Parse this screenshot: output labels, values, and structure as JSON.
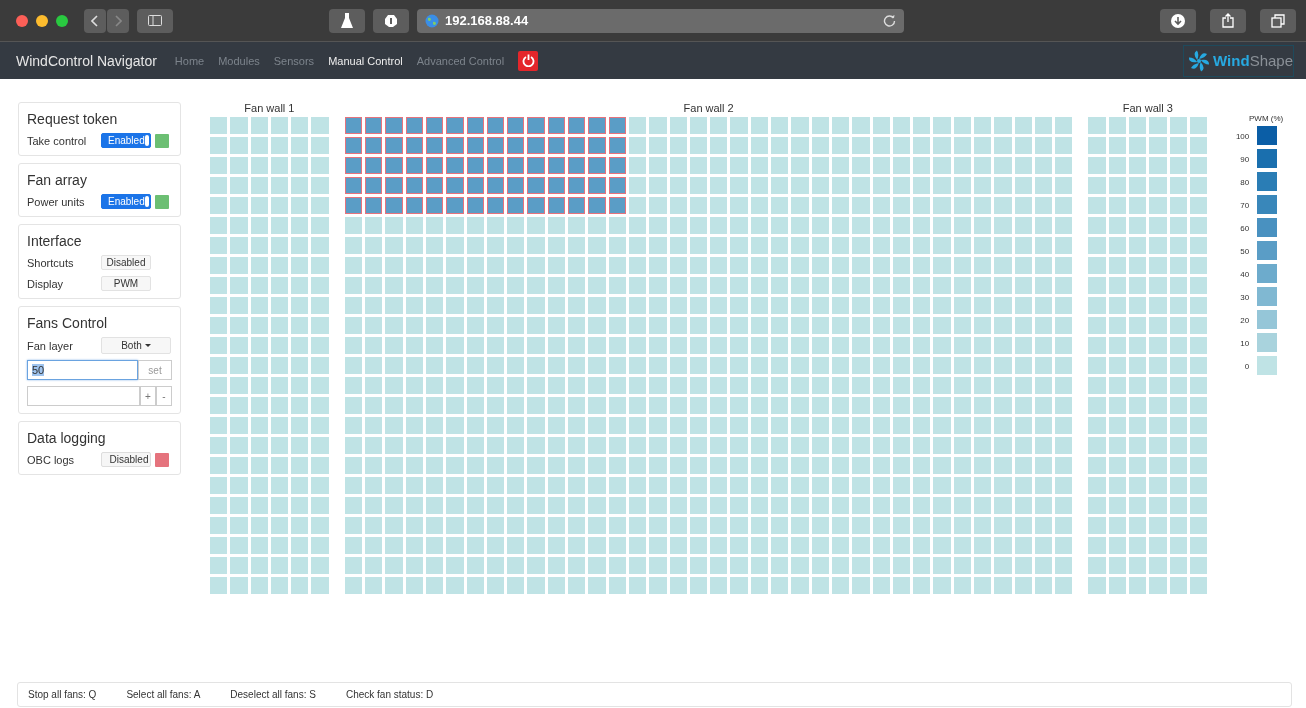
{
  "browser": {
    "url": "192.168.88.44"
  },
  "nav": {
    "brand": "WindControl Navigator",
    "links": [
      {
        "label": "Home",
        "selected": false
      },
      {
        "label": "Modules",
        "selected": false
      },
      {
        "label": "Sensors",
        "selected": false
      },
      {
        "label": "Manual Control",
        "selected": true
      },
      {
        "label": "Advanced Control",
        "selected": false
      }
    ],
    "logo": [
      "Wind",
      "Shape"
    ]
  },
  "panels": [
    {
      "title": "Request token",
      "rows": [
        {
          "kind": "toggle",
          "label": "Take control",
          "value": "Enabled",
          "on": true,
          "color": "#6cbf73"
        }
      ]
    },
    {
      "title": "Fan array",
      "rows": [
        {
          "kind": "toggle",
          "label": "Power units",
          "value": "Enabled",
          "on": true,
          "color": "#6cbf73"
        }
      ]
    },
    {
      "title": "Interface",
      "rows": [
        {
          "kind": "button",
          "label": "Shortcuts",
          "value": "Disabled"
        },
        {
          "kind": "button",
          "label": "Display",
          "value": "PWM"
        }
      ]
    },
    {
      "title": "Fans Control",
      "rows": [
        {
          "kind": "dropdown",
          "label": "Fan layer",
          "value": "Both"
        },
        {
          "kind": "input",
          "value": "50",
          "button": "set"
        },
        {
          "kind": "stepper",
          "plus": "+",
          "minus": "-"
        }
      ]
    },
    {
      "title": "Data logging",
      "rows": [
        {
          "kind": "toggle",
          "label": "OBC logs",
          "value": "Disabled",
          "on": false,
          "color": "#e5737d"
        }
      ]
    }
  ],
  "fan_walls": [
    {
      "title": "Fan wall 1",
      "rows": [
        [
          false,
          false,
          false,
          false,
          false,
          false
        ],
        [
          false,
          false,
          false,
          false,
          false,
          false
        ],
        [
          false,
          false,
          false,
          false,
          false,
          false
        ],
        [
          false,
          false,
          false,
          false,
          false,
          false
        ],
        [
          false,
          false,
          false,
          false,
          false,
          false
        ],
        [
          false,
          false,
          false,
          false,
          false,
          false
        ],
        [
          false,
          false,
          false,
          false,
          false,
          false
        ],
        [
          false,
          false,
          false,
          false,
          false,
          false
        ],
        [
          false,
          false,
          false,
          false,
          false,
          false
        ],
        [
          false,
          false,
          false,
          false,
          false,
          false
        ],
        [
          false,
          false,
          false,
          false,
          false,
          false
        ],
        [
          false,
          false,
          false,
          false,
          false,
          false
        ],
        [
          false,
          false,
          false,
          false,
          false,
          false
        ],
        [
          false,
          false,
          false,
          false,
          false,
          false
        ],
        [
          false,
          false,
          false,
          false,
          false,
          false
        ],
        [
          false,
          false,
          false,
          false,
          false,
          false
        ],
        [
          false,
          false,
          false,
          false,
          false,
          false
        ],
        [
          false,
          false,
          false,
          false,
          false,
          false
        ],
        [
          false,
          false,
          false,
          false,
          false,
          false
        ],
        [
          false,
          false,
          false,
          false,
          false,
          false
        ],
        [
          false,
          false,
          false,
          false,
          false,
          false
        ],
        [
          false,
          false,
          false,
          false,
          false,
          false
        ],
        [
          false,
          false,
          false,
          false,
          false,
          false
        ],
        [
          false,
          false,
          false,
          false,
          false,
          false
        ]
      ]
    },
    {
      "title": "Fan wall 2",
      "rows": [
        [
          true,
          true,
          true,
          true,
          true,
          true,
          true,
          true,
          true,
          true,
          true,
          true,
          true,
          true,
          false,
          false,
          false,
          false,
          false,
          false,
          false,
          false,
          false,
          false,
          false,
          false,
          false,
          false,
          false,
          false,
          false,
          false,
          false,
          false,
          false,
          false
        ],
        [
          true,
          true,
          true,
          true,
          true,
          true,
          true,
          true,
          true,
          true,
          true,
          true,
          true,
          true,
          false,
          false,
          false,
          false,
          false,
          false,
          false,
          false,
          false,
          false,
          false,
          false,
          false,
          false,
          false,
          false,
          false,
          false,
          false,
          false,
          false,
          false
        ],
        [
          true,
          true,
          true,
          true,
          true,
          true,
          true,
          true,
          true,
          true,
          true,
          true,
          true,
          true,
          false,
          false,
          false,
          false,
          false,
          false,
          false,
          false,
          false,
          false,
          false,
          false,
          false,
          false,
          false,
          false,
          false,
          false,
          false,
          false,
          false,
          false
        ],
        [
          true,
          true,
          true,
          true,
          true,
          true,
          true,
          true,
          true,
          true,
          true,
          true,
          true,
          true,
          false,
          false,
          false,
          false,
          false,
          false,
          false,
          false,
          false,
          false,
          false,
          false,
          false,
          false,
          false,
          false,
          false,
          false,
          false,
          false,
          false,
          false
        ],
        [
          true,
          true,
          true,
          true,
          true,
          true,
          true,
          true,
          true,
          true,
          true,
          true,
          true,
          true,
          false,
          false,
          false,
          false,
          false,
          false,
          false,
          false,
          false,
          false,
          false,
          false,
          false,
          false,
          false,
          false,
          false,
          false,
          false,
          false,
          false,
          false
        ],
        [
          false,
          false,
          false,
          false,
          false,
          false,
          false,
          false,
          false,
          false,
          false,
          false,
          false,
          false,
          false,
          false,
          false,
          false,
          false,
          false,
          false,
          false,
          false,
          false,
          false,
          false,
          false,
          false,
          false,
          false,
          false,
          false,
          false,
          false,
          false,
          false
        ],
        [
          false,
          false,
          false,
          false,
          false,
          false,
          false,
          false,
          false,
          false,
          false,
          false,
          false,
          false,
          false,
          false,
          false,
          false,
          false,
          false,
          false,
          false,
          false,
          false,
          false,
          false,
          false,
          false,
          false,
          false,
          false,
          false,
          false,
          false,
          false,
          false
        ],
        [
          false,
          false,
          false,
          false,
          false,
          false,
          false,
          false,
          false,
          false,
          false,
          false,
          false,
          false,
          false,
          false,
          false,
          false,
          false,
          false,
          false,
          false,
          false,
          false,
          false,
          false,
          false,
          false,
          false,
          false,
          false,
          false,
          false,
          false,
          false,
          false
        ],
        [
          false,
          false,
          false,
          false,
          false,
          false,
          false,
          false,
          false,
          false,
          false,
          false,
          false,
          false,
          false,
          false,
          false,
          false,
          false,
          false,
          false,
          false,
          false,
          false,
          false,
          false,
          false,
          false,
          false,
          false,
          false,
          false,
          false,
          false,
          false,
          false
        ],
        [
          false,
          false,
          false,
          false,
          false,
          false,
          false,
          false,
          false,
          false,
          false,
          false,
          false,
          false,
          false,
          false,
          false,
          false,
          false,
          false,
          false,
          false,
          false,
          false,
          false,
          false,
          false,
          false,
          false,
          false,
          false,
          false,
          false,
          false,
          false,
          false
        ],
        [
          false,
          false,
          false,
          false,
          false,
          false,
          false,
          false,
          false,
          false,
          false,
          false,
          false,
          false,
          false,
          false,
          false,
          false,
          false,
          false,
          false,
          false,
          false,
          false,
          false,
          false,
          false,
          false,
          false,
          false,
          false,
          false,
          false,
          false,
          false,
          false
        ],
        [
          false,
          false,
          false,
          false,
          false,
          false,
          false,
          false,
          false,
          false,
          false,
          false,
          false,
          false,
          false,
          false,
          false,
          false,
          false,
          false,
          false,
          false,
          false,
          false,
          false,
          false,
          false,
          false,
          false,
          false,
          false,
          false,
          false,
          false,
          false,
          false
        ],
        [
          false,
          false,
          false,
          false,
          false,
          false,
          false,
          false,
          false,
          false,
          false,
          false,
          false,
          false,
          false,
          false,
          false,
          false,
          false,
          false,
          false,
          false,
          false,
          false,
          false,
          false,
          false,
          false,
          false,
          false,
          false,
          false,
          false,
          false,
          false,
          false
        ],
        [
          false,
          false,
          false,
          false,
          false,
          false,
          false,
          false,
          false,
          false,
          false,
          false,
          false,
          false,
          false,
          false,
          false,
          false,
          false,
          false,
          false,
          false,
          false,
          false,
          false,
          false,
          false,
          false,
          false,
          false,
          false,
          false,
          false,
          false,
          false,
          false
        ],
        [
          false,
          false,
          false,
          false,
          false,
          false,
          false,
          false,
          false,
          false,
          false,
          false,
          false,
          false,
          false,
          false,
          false,
          false,
          false,
          false,
          false,
          false,
          false,
          false,
          false,
          false,
          false,
          false,
          false,
          false,
          false,
          false,
          false,
          false,
          false,
          false
        ],
        [
          false,
          false,
          false,
          false,
          false,
          false,
          false,
          false,
          false,
          false,
          false,
          false,
          false,
          false,
          false,
          false,
          false,
          false,
          false,
          false,
          false,
          false,
          false,
          false,
          false,
          false,
          false,
          false,
          false,
          false,
          false,
          false,
          false,
          false,
          false,
          false
        ],
        [
          false,
          false,
          false,
          false,
          false,
          false,
          false,
          false,
          false,
          false,
          false,
          false,
          false,
          false,
          false,
          false,
          false,
          false,
          false,
          false,
          false,
          false,
          false,
          false,
          false,
          false,
          false,
          false,
          false,
          false,
          false,
          false,
          false,
          false,
          false,
          false
        ],
        [
          false,
          false,
          false,
          false,
          false,
          false,
          false,
          false,
          false,
          false,
          false,
          false,
          false,
          false,
          false,
          false,
          false,
          false,
          false,
          false,
          false,
          false,
          false,
          false,
          false,
          false,
          false,
          false,
          false,
          false,
          false,
          false,
          false,
          false,
          false,
          false
        ],
        [
          false,
          false,
          false,
          false,
          false,
          false,
          false,
          false,
          false,
          false,
          false,
          false,
          false,
          false,
          false,
          false,
          false,
          false,
          false,
          false,
          false,
          false,
          false,
          false,
          false,
          false,
          false,
          false,
          false,
          false,
          false,
          false,
          false,
          false,
          false,
          false
        ],
        [
          false,
          false,
          false,
          false,
          false,
          false,
          false,
          false,
          false,
          false,
          false,
          false,
          false,
          false,
          false,
          false,
          false,
          false,
          false,
          false,
          false,
          false,
          false,
          false,
          false,
          false,
          false,
          false,
          false,
          false,
          false,
          false,
          false,
          false,
          false,
          false
        ],
        [
          false,
          false,
          false,
          false,
          false,
          false,
          false,
          false,
          false,
          false,
          false,
          false,
          false,
          false,
          false,
          false,
          false,
          false,
          false,
          false,
          false,
          false,
          false,
          false,
          false,
          false,
          false,
          false,
          false,
          false,
          false,
          false,
          false,
          false,
          false,
          false
        ],
        [
          false,
          false,
          false,
          false,
          false,
          false,
          false,
          false,
          false,
          false,
          false,
          false,
          false,
          false,
          false,
          false,
          false,
          false,
          false,
          false,
          false,
          false,
          false,
          false,
          false,
          false,
          false,
          false,
          false,
          false,
          false,
          false,
          false,
          false,
          false,
          false
        ],
        [
          false,
          false,
          false,
          false,
          false,
          false,
          false,
          false,
          false,
          false,
          false,
          false,
          false,
          false,
          false,
          false,
          false,
          false,
          false,
          false,
          false,
          false,
          false,
          false,
          false,
          false,
          false,
          false,
          false,
          false,
          false,
          false,
          false,
          false,
          false,
          false
        ],
        [
          false,
          false,
          false,
          false,
          false,
          false,
          false,
          false,
          false,
          false,
          false,
          false,
          false,
          false,
          false,
          false,
          false,
          false,
          false,
          false,
          false,
          false,
          false,
          false,
          false,
          false,
          false,
          false,
          false,
          false,
          false,
          false,
          false,
          false,
          false,
          false
        ]
      ]
    },
    {
      "title": "Fan wall 3",
      "rows": [
        [
          false,
          false,
          false,
          false,
          false,
          false
        ],
        [
          false,
          false,
          false,
          false,
          false,
          false
        ],
        [
          false,
          false,
          false,
          false,
          false,
          false
        ],
        [
          false,
          false,
          false,
          false,
          false,
          false
        ],
        [
          false,
          false,
          false,
          false,
          false,
          false
        ],
        [
          false,
          false,
          false,
          false,
          false,
          false
        ],
        [
          false,
          false,
          false,
          false,
          false,
          false
        ],
        [
          false,
          false,
          false,
          false,
          false,
          false
        ],
        [
          false,
          false,
          false,
          false,
          false,
          false
        ],
        [
          false,
          false,
          false,
          false,
          false,
          false
        ],
        [
          false,
          false,
          false,
          false,
          false,
          false
        ],
        [
          false,
          false,
          false,
          false,
          false,
          false
        ],
        [
          false,
          false,
          false,
          false,
          false,
          false
        ],
        [
          false,
          false,
          false,
          false,
          false,
          false
        ],
        [
          false,
          false,
          false,
          false,
          false,
          false
        ],
        [
          false,
          false,
          false,
          false,
          false,
          false
        ],
        [
          false,
          false,
          false,
          false,
          false,
          false
        ],
        [
          false,
          false,
          false,
          false,
          false,
          false
        ],
        [
          false,
          false,
          false,
          false,
          false,
          false
        ],
        [
          false,
          false,
          false,
          false,
          false,
          false
        ],
        [
          false,
          false,
          false,
          false,
          false,
          false
        ],
        [
          false,
          false,
          false,
          false,
          false,
          false
        ],
        [
          false,
          false,
          false,
          false,
          false,
          false
        ],
        [
          false,
          false,
          false,
          false,
          false,
          false
        ]
      ]
    }
  ],
  "legend": {
    "title": "PWM (%)",
    "steps": [
      {
        "label": "100",
        "color": "#0b5ea6"
      },
      {
        "label": "90",
        "color": "#1a6fae"
      },
      {
        "label": "80",
        "color": "#2a7db5"
      },
      {
        "label": "70",
        "color": "#3987ba"
      },
      {
        "label": "60",
        "color": "#4991c0"
      },
      {
        "label": "50",
        "color": "#5a9dc6"
      },
      {
        "label": "40",
        "color": "#6dabcc"
      },
      {
        "label": "30",
        "color": "#80b8d2"
      },
      {
        "label": "20",
        "color": "#95c6d8"
      },
      {
        "label": "10",
        "color": "#a9d3dd"
      },
      {
        "label": "0",
        "color": "#bfe3e5"
      }
    ]
  },
  "status_bar": [
    "Stop all fans: Q",
    "Select all fans: A",
    "Deselect all fans: S",
    "Check fan status: D"
  ]
}
